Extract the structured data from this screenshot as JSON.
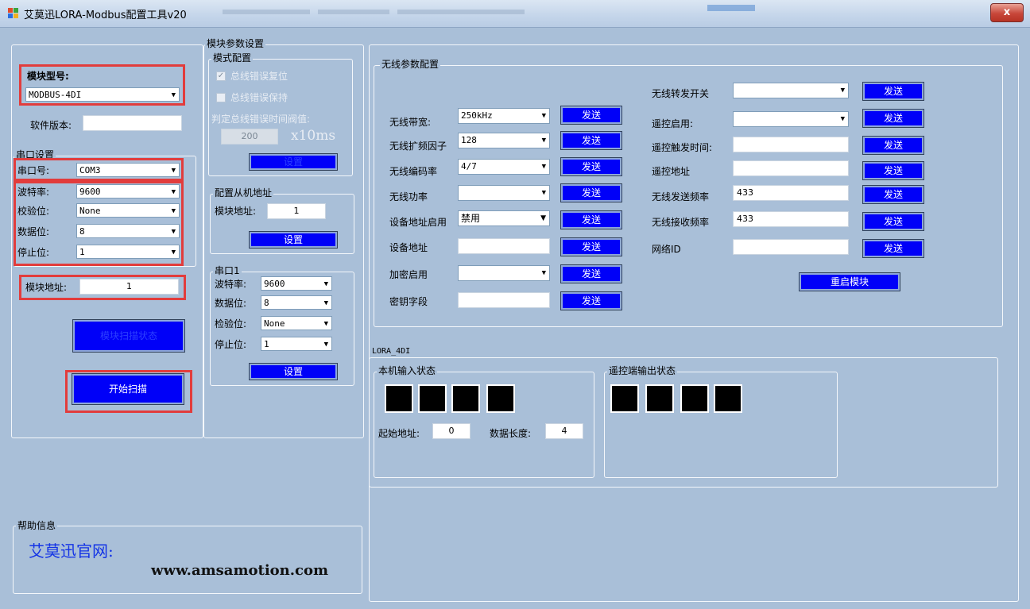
{
  "window": {
    "title": "艾莫迅LORA-Modbus配置工具v20",
    "close_label": "x"
  },
  "left": {
    "model_label": "模块型号:",
    "model_value": "MODBUS-4DI",
    "sw_version_label": "软件版本:",
    "sw_version_value": "",
    "serial_group": "串口设置",
    "port_label": "串口号:",
    "port_value": "COM3",
    "baud_label": "波特率:",
    "baud_value": "9600",
    "parity_label": "校验位:",
    "parity_value": "None",
    "databits_label": "数据位:",
    "databits_value": "8",
    "stopbits_label": "停止位:",
    "stopbits_value": "1",
    "addr_label": "模块地址:",
    "addr_value": "1",
    "scan_status_button": "模块扫描状态",
    "start_scan_button": "开始扫描"
  },
  "module": {
    "group_title": "模块参数设置",
    "mode_group": "模式配置",
    "bus_reset_label": "总线错误复位",
    "bus_hold_label": "总线错误保持",
    "threshold_label": "判定总线错误时间阀值:",
    "threshold_value": "200",
    "threshold_unit": "x10ms",
    "mode_set_button": "设置",
    "slave_group": "配置从机地址",
    "slave_addr_label": "模块地址:",
    "slave_addr_value": "1",
    "slave_set_button": "设置",
    "serial1_group": "串口1",
    "s1_baud_label": "波特率:",
    "s1_baud_value": "9600",
    "s1_databits_label": "数据位:",
    "s1_databits_value": "8",
    "s1_parity_label": "检验位:",
    "s1_parity_value": "None",
    "s1_stopbits_label": "停止位:",
    "s1_stopbits_value": "1",
    "serial1_set_button": "设置"
  },
  "wireless": {
    "group_title": "无线参数配置",
    "send_label": "发送",
    "bandwidth_label": "无线带宽:",
    "bandwidth_value": "250kHz",
    "sf_label": "无线扩频因子",
    "sf_value": "128",
    "cr_label": "无线编码率",
    "cr_value": "4/7",
    "power_label": "无线功率",
    "power_value": "",
    "addr_enable_label": "设备地址启用",
    "addr_enable_value": "禁用",
    "dev_addr_label": "设备地址",
    "dev_addr_value": "",
    "encrypt_label": "加密启用",
    "encrypt_value": "",
    "key_label": "密钥字段",
    "key_value": "",
    "relay_label": "无线转发开关",
    "relay_value": "",
    "remote_enable_label": "遥控启用:",
    "remote_enable_value": "",
    "remote_trigger_label": "遥控触发时间:",
    "remote_trigger_value": "",
    "remote_addr_label": "遥控地址",
    "remote_addr_value": "",
    "tx_freq_label": "无线发送频率",
    "tx_freq_value": "433",
    "rx_freq_label": "无线接收频率",
    "rx_freq_value": "433",
    "net_id_label": "网络ID",
    "net_id_value": "",
    "restart_button": "重启模块"
  },
  "lora": {
    "group_title": "LORA_4DI",
    "local_input_group": "本机输入状态",
    "remote_output_group": "遥控端输出状态",
    "start_addr_label": "起始地址:",
    "start_addr_value": "0",
    "data_len_label": "数据长度:",
    "data_len_value": "4"
  },
  "help": {
    "group_title": "帮助信息",
    "site_label": "艾莫迅官网:",
    "url": "www.amsamotion.com"
  },
  "colors": {
    "background": "#a9bfd8",
    "button_blue": "#0000f8",
    "highlight_red": "#e23c3c"
  }
}
